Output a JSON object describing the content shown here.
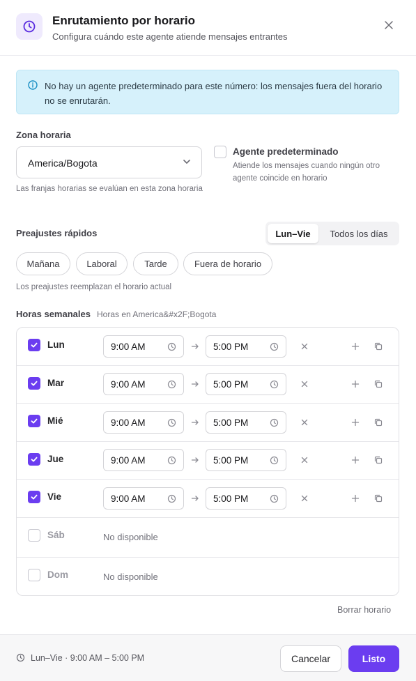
{
  "dialog": {
    "title": "Enrutamiento por horario",
    "subtitle": "Configura cuándo este agente atiende mensajes entrantes",
    "icon": "clock-icon",
    "accent_color": "#6b3df0"
  },
  "info_banner": {
    "text": "No hay un agente predeterminado para este número: los mensajes fuera del horario no se enrutarán."
  },
  "timezone": {
    "label": "Zona horaria",
    "value": "America/Bogota",
    "hint": "Las franjas horarias se evalúan en esta zona horaria"
  },
  "default_agent": {
    "checked": false,
    "title": "Agente predeterminado",
    "description": "Atiende los mensajes cuando ningún otro agente coincide en horario"
  },
  "presets": {
    "label": "Preajustes rápidos",
    "segments": [
      {
        "label": "Lun–Vie",
        "active": true
      },
      {
        "label": "Todos los días",
        "active": false
      }
    ],
    "pills": [
      "Mañana",
      "Laboral",
      "Tarde",
      "Fuera de horario"
    ],
    "hint": "Los preajustes reemplazan el horario actual"
  },
  "weekly": {
    "label": "Horas semanales",
    "sublabel": "Horas en America&#x2F;Bogota",
    "days": [
      {
        "name": "Lun",
        "enabled": true,
        "start": "9:00 AM",
        "end": "5:00 PM"
      },
      {
        "name": "Mar",
        "enabled": true,
        "start": "9:00 AM",
        "end": "5:00 PM"
      },
      {
        "name": "Mié",
        "enabled": true,
        "start": "9:00 AM",
        "end": "5:00 PM"
      },
      {
        "name": "Jue",
        "enabled": true,
        "start": "9:00 AM",
        "end": "5:00 PM"
      },
      {
        "name": "Vie",
        "enabled": true,
        "start": "9:00 AM",
        "end": "5:00 PM"
      },
      {
        "name": "Sáb",
        "enabled": false,
        "unavailable": "No disponible"
      },
      {
        "name": "Dom",
        "enabled": false,
        "unavailable": "No disponible"
      }
    ],
    "clear_label": "Borrar horario"
  },
  "footer": {
    "summary": "Lun–Vie · 9:00 AM – 5:00 PM",
    "cancel_label": "Cancelar",
    "done_label": "Listo"
  }
}
